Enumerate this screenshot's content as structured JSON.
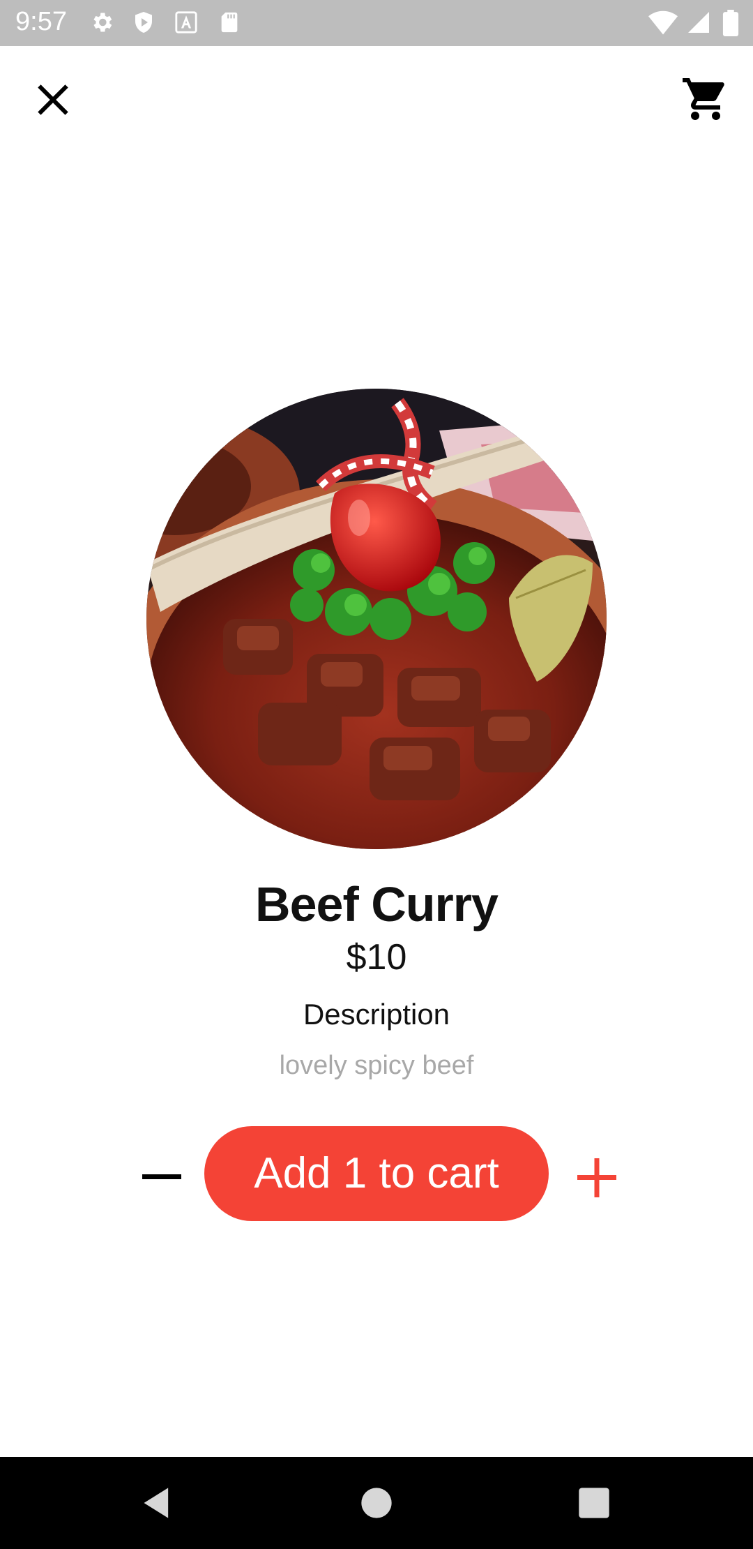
{
  "status_bar": {
    "time": "9:57",
    "icons": [
      "settings-icon",
      "shield-play-icon",
      "font-a-icon",
      "sd-card-icon",
      "wifi-icon",
      "signal-icon",
      "battery-icon"
    ]
  },
  "header": {
    "close_icon": "close-icon",
    "cart_icon": "shopping-cart-icon"
  },
  "product": {
    "name": "Beef Curry",
    "price": "$10",
    "description_heading": "Description",
    "description": "lovely spicy beef"
  },
  "order": {
    "add_button_label": "Add 1 to cart",
    "decrement_icon": "minus-icon",
    "increment_icon": "plus-icon"
  },
  "colors": {
    "accent": "#f44336",
    "status_bar": "#bdbdbd",
    "nav_bar": "#000000"
  },
  "nav_bar": {
    "icons": [
      "back-icon",
      "home-icon",
      "recents-icon"
    ]
  }
}
